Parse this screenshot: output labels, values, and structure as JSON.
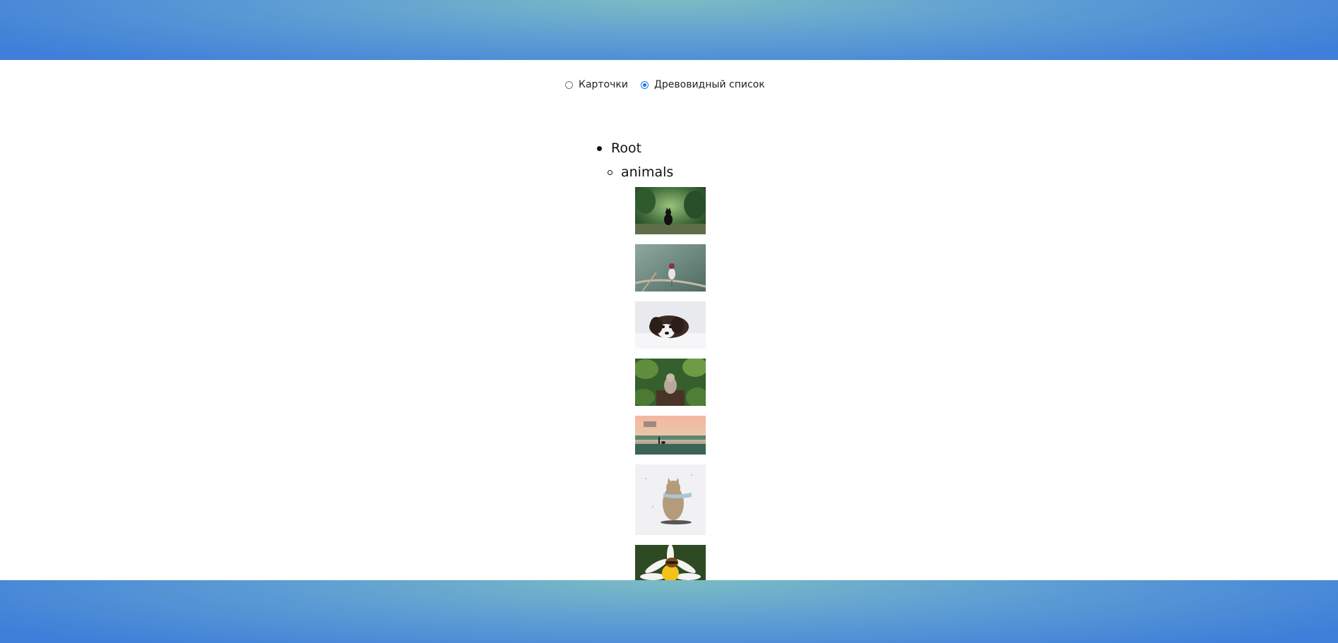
{
  "view_toggle": {
    "options": [
      {
        "label": "Карточки",
        "checked": false
      },
      {
        "label": "Древовидный список",
        "checked": true
      }
    ]
  },
  "tree": {
    "root_label": "Root",
    "children": [
      {
        "label": "animals",
        "images": [
          {
            "name": "black-cat-forest-image"
          },
          {
            "name": "bird-on-branch-image"
          },
          {
            "name": "dog-in-snow-image"
          },
          {
            "name": "monkey-in-leaves-image"
          },
          {
            "name": "beach-sunset-image"
          },
          {
            "name": "cartoon-hamster-image"
          },
          {
            "name": "bee-on-daisy-image"
          }
        ]
      }
    ]
  },
  "colors": {
    "band_center": "#7cbcc4",
    "band_edge": "#3f7fd9",
    "radio_accent": "#1a73e8"
  }
}
